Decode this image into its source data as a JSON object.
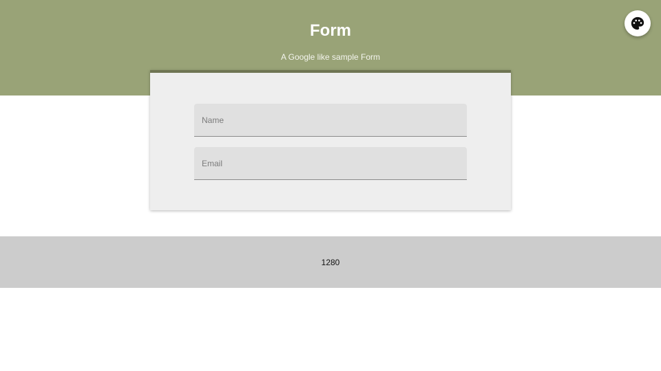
{
  "header": {
    "title": "Form",
    "subtitle": "A Google like sample Form",
    "background_color": "#99a377"
  },
  "theme_button": {
    "icon": "palette-icon"
  },
  "form": {
    "accent_color": "#6f7553",
    "fields": [
      {
        "placeholder": "Name",
        "value": ""
      },
      {
        "placeholder": "Email",
        "value": ""
      }
    ]
  },
  "footer": {
    "text": "1280",
    "background_color": "#cccccc"
  }
}
